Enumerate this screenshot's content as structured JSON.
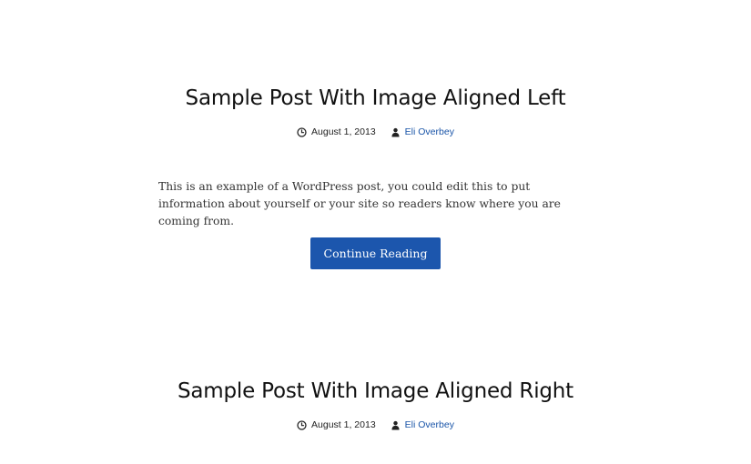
{
  "posts": [
    {
      "title": "Sample Post With Image Aligned Left",
      "date": "August 1, 2013",
      "author": "Eli Overbey",
      "excerpt": "This is an example of a WordPress post, you could edit this to put information about yourself or your site so readers know where you are coming from.",
      "button_label": "Continue Reading"
    },
    {
      "title": "Sample Post With Image Aligned Right",
      "date": "August 1, 2013",
      "author": "Eli Overbey"
    }
  ],
  "icons": {
    "date": "clock-icon",
    "author": "user-icon"
  },
  "colors": {
    "link": "#1a55a8",
    "button_bg": "#1c56ad",
    "button_text": "#ffffff",
    "title": "#111111"
  }
}
